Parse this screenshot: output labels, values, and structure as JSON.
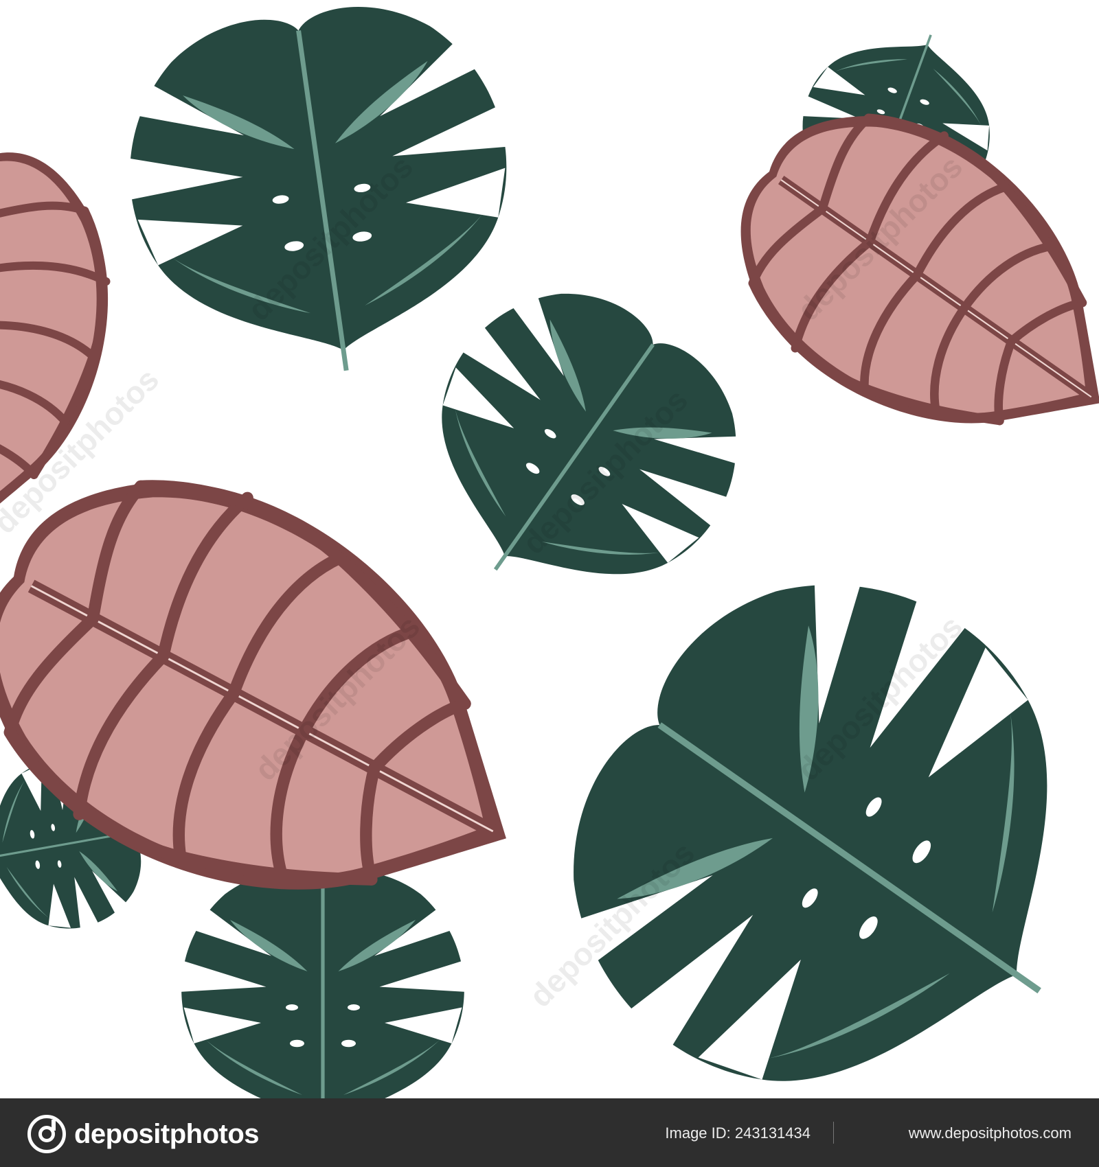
{
  "colors": {
    "background": "#ffffff",
    "monstera_dark": "#264840",
    "monstera_light": "#6e9c8e",
    "alocasia_fill": "#cf9996",
    "alocasia_veins": "#7c4646",
    "footer": "#2e2e2e"
  },
  "watermark": {
    "text": "depositphotos"
  },
  "footer": {
    "brand": "depositphotos",
    "brand_icon": "depositphotos-logo-icon",
    "image_id": "Image ID: 243131434",
    "website": "www.depositphotos.com"
  }
}
